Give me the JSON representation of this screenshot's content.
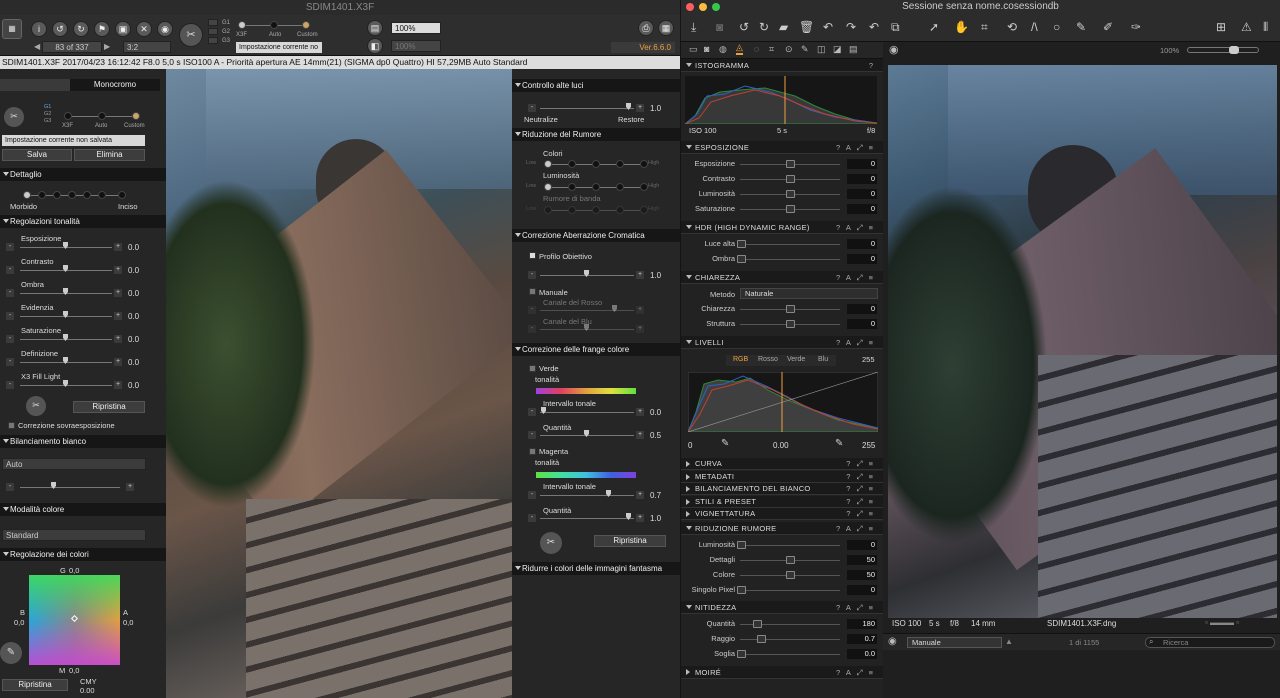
{
  "spp": {
    "title": "SDIM1401.X3F",
    "frame_counter": "83 of 337",
    "ratio": "3:2",
    "g_labels": [
      "G1",
      "G2",
      "G3"
    ],
    "mode_labels": [
      "X3F",
      "Auto",
      "Custom"
    ],
    "preset_current": "Impostazione corrente no",
    "zoom1": "100%",
    "zoom2": "100%",
    "version": "Ver.6.6.0",
    "status_bar": "SDIM1401.X3F 2017/04/23 16:12:42 F8.0 5,0 s ISO100 A - Priorità apertura AE 14mm(21) (SIGMA dp0 Quattro) HI 57,29MB Auto Standard",
    "tab_mono": "Monocromo",
    "preset_unsaved": "Impostazione corrente non salvata",
    "btn_save": "Salva",
    "btn_delete": "Elimina",
    "detail_head": "Dettaglio",
    "detail_soft": "Morbido",
    "detail_sharp": "Inciso",
    "tonal_head": "Regolazioni tonalità",
    "tonal": [
      {
        "label": "Esposizione",
        "value": "0.0"
      },
      {
        "label": "Contrasto",
        "value": "0.0"
      },
      {
        "label": "Ombra",
        "value": "0.0"
      },
      {
        "label": "Evidenzia",
        "value": "0.0"
      },
      {
        "label": "Saturazione",
        "value": "0.0"
      },
      {
        "label": "Definizione",
        "value": "0.0"
      },
      {
        "label": "X3 Fill Light",
        "value": "0.0"
      }
    ],
    "btn_restore": "Ripristina",
    "overexp": "Correzione sovraesposizione",
    "wb_head": "Bilanciamento bianco",
    "wb_value": "Auto",
    "color_mode_head": "Modalità colore",
    "color_mode_value": "Standard",
    "color_adj_head": "Regolazione dei colori",
    "color_g": "G",
    "color_b": "B",
    "color_a": "A",
    "color_m": "M",
    "color_g_val": "0,0",
    "color_b_val": "0,0",
    "color_a_val": "0,0",
    "color_m_val": "0,0",
    "cmy": "CMY",
    "cmy_val": "0.00",
    "btn_restore2": "Ripristina",
    "hl_head": "Controllo alte luci",
    "hl_value": "1.0",
    "hl_neutral": "Neutralize",
    "hl_restore": "Restore",
    "nr_head": "Riduzione del Rumore",
    "nr_colori": "Colori",
    "nr_lum": "Luminosità",
    "nr_banding": "Rumore di banda",
    "nr_low": "Low",
    "nr_high": "High",
    "ca_head": "Correzione Aberrazione Cromatica",
    "ca_profile": "Profilo Obiettivo",
    "ca_value": "1.0",
    "ca_manual": "Manuale",
    "ca_red": "Canale del Rosso",
    "ca_blue": "Canale del Blu",
    "fringe_head": "Correzione delle frange colore",
    "fringe_green": "Verde",
    "fringe_hue": "tonalità",
    "fringe_range": "Intervallo tonale",
    "fringe_qty": "Quantità",
    "fringe_green_range": "0.0",
    "fringe_green_qty": "0.5",
    "fringe_magenta": "Magenta",
    "fringe_mag_range": "0.7",
    "fringe_mag_qty": "1.0",
    "btn_restore3": "Ripristina",
    "ghost_head": "Ridurre i colori delle immagini fantasma"
  },
  "c1": {
    "title": "Sessione senza nome.cosessiondb",
    "hist_head": "ISTOGRAMMA",
    "hist_iso": "ISO 100",
    "hist_shutter": "5 s",
    "hist_f": "f/8",
    "exp_head": "ESPOSIZIONE",
    "exposure": [
      {
        "label": "Esposizione",
        "value": "0"
      },
      {
        "label": "Contrasto",
        "value": "0"
      },
      {
        "label": "Luminosità",
        "value": "0"
      },
      {
        "label": "Saturazione",
        "value": "0"
      }
    ],
    "hdr_head": "HDR (HIGH DYNAMIC RANGE)",
    "hdr": [
      {
        "label": "Luce alta",
        "value": "0"
      },
      {
        "label": "Ombra",
        "value": "0"
      }
    ],
    "clarity_head": "CHIAREZZA",
    "clarity_method_label": "Metodo",
    "clarity_method": "Naturale",
    "clarity": [
      {
        "label": "Chiarezza",
        "value": "0"
      },
      {
        "label": "Struttura",
        "value": "0"
      }
    ],
    "levels_head": "LIVELLI",
    "levels_tabs": [
      "RGB",
      "Rosso",
      "Verde",
      "Blu"
    ],
    "levels_max_top": "255",
    "levels_min": "0",
    "levels_mid": "0.00",
    "levels_max": "255",
    "collapsed": [
      "CURVA",
      "METADATI",
      "BILANCIAMENTO DEL BIANCO",
      "STILI & PRESET",
      "VIGNETTATURA"
    ],
    "nr_head": "RIDUZIONE RUMORE",
    "nr": [
      {
        "label": "Luminosità",
        "value": "0"
      },
      {
        "label": "Dettagli",
        "value": "50"
      },
      {
        "label": "Colore",
        "value": "50"
      },
      {
        "label": "Singolo Pixel",
        "value": "0"
      }
    ],
    "sharp_head": "NITIDEZZA",
    "sharp": [
      {
        "label": "Quantità",
        "value": "180"
      },
      {
        "label": "Raggio",
        "value": "0.7"
      },
      {
        "label": "Soglia",
        "value": "0.0"
      }
    ],
    "moire_head": "MOIRÉ",
    "zoom": "100%",
    "view_iso": "ISO 100",
    "view_shutter": "5 s",
    "view_f": "f/8",
    "view_focal": "14 mm",
    "view_filename": "SDIM1401.X3F.dng",
    "collection": "Manuale",
    "count": "1 di 1155",
    "search_placeholder": "Ricerca"
  }
}
